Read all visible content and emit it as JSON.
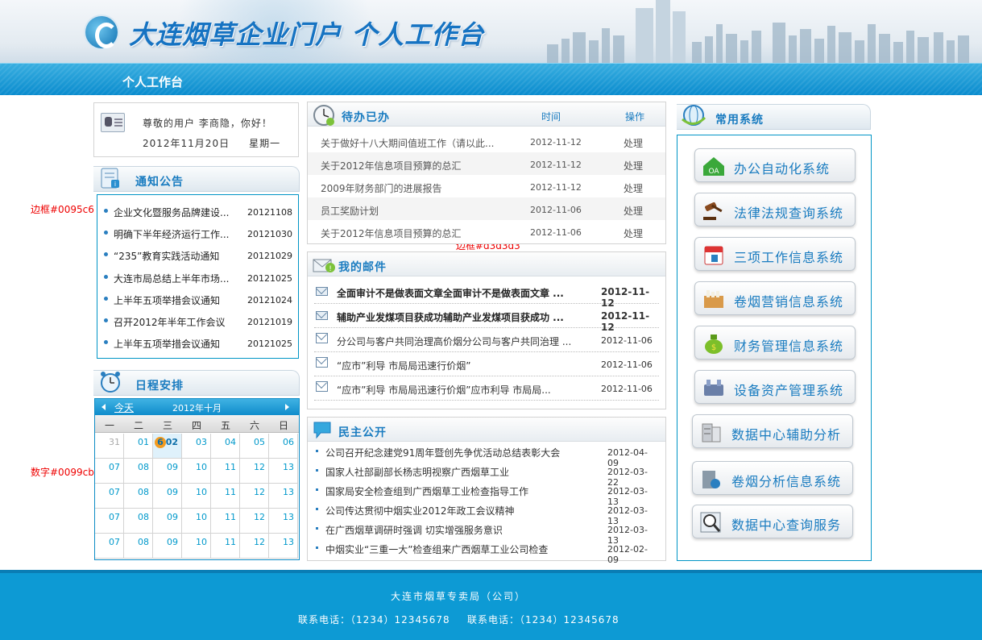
{
  "header": {
    "site_title": "大连烟草企业门户 个人工作台",
    "subnav_title": "个人工作台"
  },
  "annotations": {
    "border_left": "边框#0095c6",
    "border_mid": "边框#d3d3d3",
    "digits": "数字#0099cb"
  },
  "colors": {
    "border_blue": "#0095c6",
    "border_gray": "#d3d3d3",
    "digit_blue": "#0099cb"
  },
  "user": {
    "greeting": "尊敬的用户 李商隐，你好！",
    "date": "2012年11月20日",
    "weekday": "星期一"
  },
  "notice": {
    "title": "通知公告",
    "items": [
      {
        "text": "企业文化暨服务品牌建设...",
        "date": "20121108"
      },
      {
        "text": "明确下半年经济运行工作...",
        "date": "20121030"
      },
      {
        "text": "“235”教育实践活动通知",
        "date": "20121029"
      },
      {
        "text": "大连市局总结上半年市场...",
        "date": "20121025"
      },
      {
        "text": "上半年五项举措会议通知",
        "date": "20121024"
      },
      {
        "text": "召开2012年半年工作会议",
        "date": "20121019"
      },
      {
        "text": "上半年五项举措会议通知",
        "date": "20121025"
      }
    ]
  },
  "schedule": {
    "title": "日程安排",
    "today_label": "今天",
    "month_label": "2012年十月",
    "weekdays": [
      "一",
      "二",
      "三",
      "四",
      "五",
      "六",
      "日"
    ],
    "rows": [
      [
        "31",
        "01",
        "02",
        "03",
        "04",
        "05",
        "06"
      ],
      [
        "07",
        "08",
        "09",
        "10",
        "11",
        "12",
        "13"
      ],
      [
        "07",
        "08",
        "09",
        "10",
        "11",
        "12",
        "13"
      ],
      [
        "07",
        "08",
        "09",
        "10",
        "11",
        "12",
        "13"
      ],
      [
        "07",
        "08",
        "09",
        "10",
        "11",
        "12",
        "13"
      ]
    ],
    "badge": "6"
  },
  "todo": {
    "title": "待办已办",
    "col_time": "时间",
    "col_action": "操作",
    "items": [
      {
        "text": "关于做好十八大期间值班工作（请以此...",
        "date": "2012-11-12",
        "action": "处理"
      },
      {
        "text": "关于2012年信息项目预算的总汇",
        "date": "2012-11-12",
        "action": "处理"
      },
      {
        "text": "2009年财务部门的进展报告",
        "date": "2012-11-12",
        "action": "处理"
      },
      {
        "text": "员工奖励计划",
        "date": "2012-11-06",
        "action": "处理"
      },
      {
        "text": "关于2012年信息项目预算的总汇",
        "date": "2012-11-06",
        "action": "处理"
      }
    ]
  },
  "mail": {
    "title": "我的邮件",
    "items": [
      {
        "text": "全面审计不是做表面文章全面审计不是做表面文章 ...",
        "date": "2012-11-12",
        "unread": true
      },
      {
        "text": "辅助产业发煤项目获成功辅助产业发煤项目获成功 ...",
        "date": "2012-11-12",
        "unread": true
      },
      {
        "text": "分公司与客户共同治理高价烟分公司与客户共同治理 ...",
        "date": "2012-11-06",
        "unread": false
      },
      {
        "text": "“应市”利导 市局局迅速行价烟”",
        "date": "2012-11-06",
        "unread": false
      },
      {
        "text": "“应市”利导 市局局迅速行价烟”应市利导 市局局...",
        "date": "2012-11-06",
        "unread": false
      }
    ]
  },
  "public": {
    "title": "民主公开",
    "items": [
      {
        "text": "公司召开纪念建党91周年暨创先争优活动总结表彰大会",
        "date": "2012-04-09"
      },
      {
        "text": "国家人社部副部长杨志明视察广西烟草工业",
        "date": "2012-03-22"
      },
      {
        "text": "国家局安全检查组到广西烟草工业检查指导工作",
        "date": "2012-03-13"
      },
      {
        "text": "公司传达贯彻中烟实业2012年政工会议精神",
        "date": "2012-03-13"
      },
      {
        "text": "在广西烟草调研时强调 切实增强服务意识",
        "date": "2012-03-13"
      },
      {
        "text": "中烟实业“三重一大”检查组来广西烟草工业公司检查",
        "date": "2012-02-09"
      }
    ]
  },
  "systems": {
    "title": "常用系统",
    "items": [
      {
        "label": "办公自动化系统",
        "icon": "oa-house-icon"
      },
      {
        "label": "法律法规查询系统",
        "icon": "gavel-icon"
      },
      {
        "label": "三项工作信息系统",
        "icon": "calendar-book-icon"
      },
      {
        "label": "卷烟营销信息系统",
        "icon": "cigarette-pack-icon"
      },
      {
        "label": "财务管理信息系统",
        "icon": "money-bag-icon"
      },
      {
        "label": "设备资产管理系统",
        "icon": "equipment-icon"
      },
      {
        "label": "数据中心辅助分析",
        "icon": "database-icon"
      },
      {
        "label": "卷烟分析信息系统",
        "icon": "analysis-icon"
      },
      {
        "label": "数据中心查询服务",
        "icon": "magnifier-icon"
      }
    ]
  },
  "footer": {
    "org": "大连市烟草专卖局（公司）",
    "contact1": "联系电话：（1234）12345678",
    "contact2": "联系电话：（1234）12345678"
  }
}
